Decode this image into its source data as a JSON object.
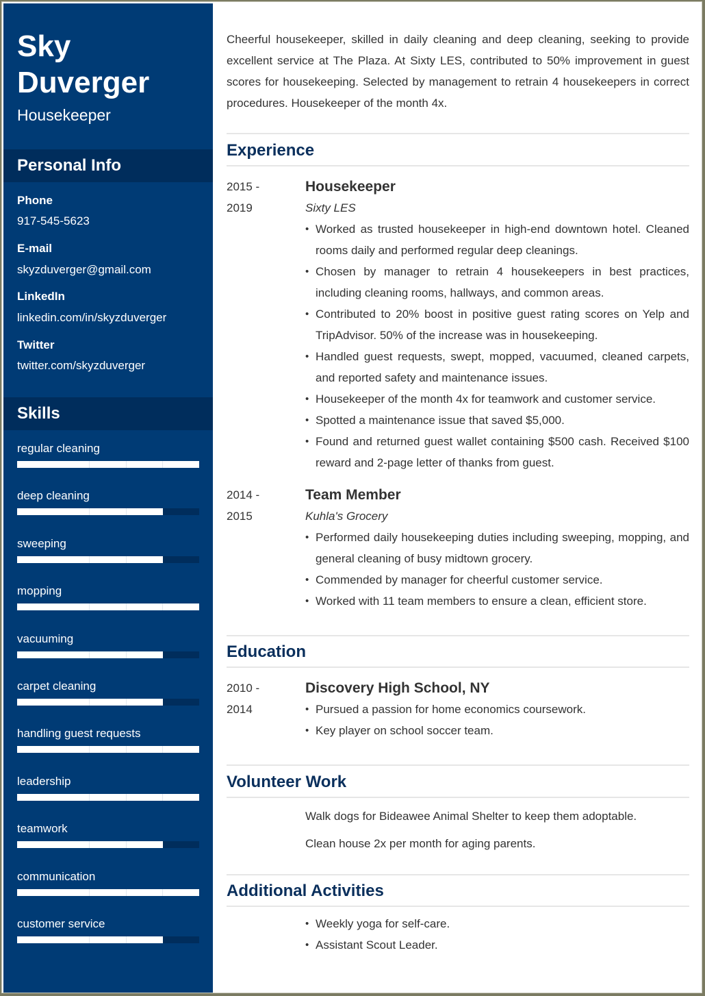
{
  "profile": {
    "first_name": "Sky",
    "last_name": "Duverger",
    "title": "Housekeeper"
  },
  "personal_info": {
    "heading": "Personal Info",
    "items": [
      {
        "label": "Phone",
        "value": "917-545-5623"
      },
      {
        "label": "E-mail",
        "value": "skyzduverger@gmail.com"
      },
      {
        "label": "LinkedIn",
        "value": "linkedin.com/in/skyzduverger"
      },
      {
        "label": "Twitter",
        "value": "twitter.com/skyzduverger"
      }
    ]
  },
  "skills": {
    "heading": "Skills",
    "scale_max": 5,
    "items": [
      {
        "name": "regular cleaning",
        "level": 5
      },
      {
        "name": "deep cleaning",
        "level": 4
      },
      {
        "name": "sweeping",
        "level": 4
      },
      {
        "name": "mopping",
        "level": 5
      },
      {
        "name": "vacuuming",
        "level": 4
      },
      {
        "name": "carpet cleaning",
        "level": 4
      },
      {
        "name": "handling guest requests",
        "level": 5
      },
      {
        "name": "leadership",
        "level": 5
      },
      {
        "name": "teamwork",
        "level": 4
      },
      {
        "name": "communication",
        "level": 5
      },
      {
        "name": "customer service",
        "level": 4
      }
    ]
  },
  "summary": "Cheerful housekeeper, skilled in daily cleaning and deep cleaning, seeking to provide excellent service at The Plaza. At Sixty LES, contributed to 50% improvement in guest scores for housekeeping. Selected by management to retrain 4 housekeepers in correct procedures. Housekeeper of the month 4x.",
  "experience": {
    "heading": "Experience",
    "jobs": [
      {
        "date_start": "2015 -",
        "date_end": "2019",
        "title": "Housekeeper",
        "company": "Sixty LES",
        "bullets": [
          "Worked as trusted housekeeper in high-end downtown hotel. Cleaned rooms daily and performed regular deep cleanings.",
          "Chosen by manager to retrain 4 housekeepers in best practices, including cleaning rooms, hallways, and common areas.",
          "Contributed to 20% boost in positive guest rating scores on Yelp and TripAdvisor. 50% of the increase was in housekeeping.",
          "Handled guest requests, swept, mopped, vacuumed, cleaned carpets, and reported safety and maintenance issues.",
          "Housekeeper of the month 4x for teamwork and customer service.",
          "Spotted a maintenance issue that saved $5,000.",
          "Found and returned guest wallet containing $500 cash. Received $100 reward and 2-page letter of thanks from guest."
        ]
      },
      {
        "date_start": "2014 -",
        "date_end": "2015",
        "title": "Team Member",
        "company": "Kuhla's Grocery",
        "bullets": [
          "Performed daily housekeeping duties including sweeping, mopping, and general cleaning of busy midtown grocery.",
          "Commended by manager for cheerful customer service.",
          "Worked with 11 team members to ensure a clean, efficient store."
        ]
      }
    ]
  },
  "education": {
    "heading": "Education",
    "date_start": "2010 -",
    "date_end": "2014",
    "school": "Discovery High School, NY",
    "bullets": [
      "Pursued a passion for home economics coursework.",
      "Key player on school soccer team."
    ]
  },
  "volunteer": {
    "heading": "Volunteer Work",
    "items": [
      "Walk dogs for Bideawee Animal Shelter to keep them adoptable.",
      "Clean house 2x per month for aging parents."
    ]
  },
  "activities": {
    "heading": "Additional Activities",
    "bullets": [
      "Weekly yoga for self-care.",
      "Assistant Scout Leader."
    ]
  },
  "colors": {
    "sidebar": "#003b75",
    "sidebar_header": "#002d5c",
    "heading": "#0a2f5c",
    "text": "#333333"
  }
}
